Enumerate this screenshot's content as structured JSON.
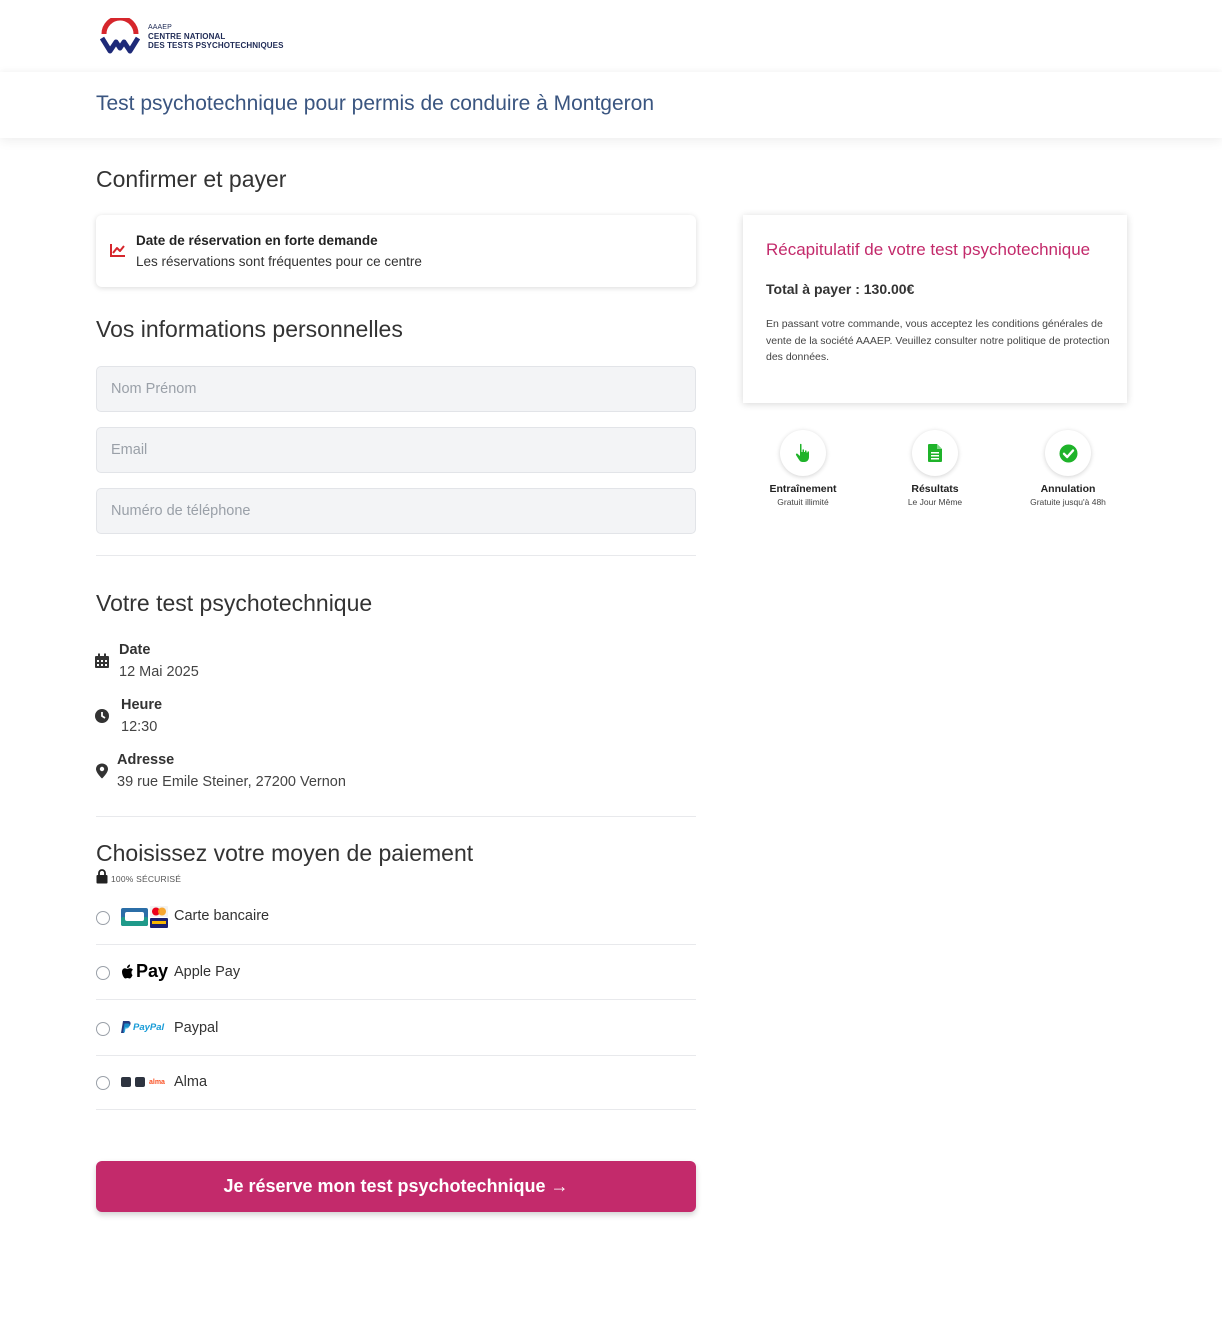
{
  "header": {
    "logo_lines": [
      "AAAEP",
      "CENTRE NATIONAL",
      "DES TESTS PSYCHOTECHNIQUES"
    ],
    "page_title": "Test psychotechnique pour permis de conduire à Montgeron"
  },
  "checkout": {
    "heading": "Confirmer et payer",
    "alert": {
      "title": "Date de réservation en forte demande",
      "text": "Les réservations sont fréquentes pour ce centre",
      "icon": "trend-chart-icon"
    }
  },
  "personal": {
    "heading": "Vos informations personnelles",
    "name_placeholder": "Nom Prénom",
    "email_placeholder": "Email",
    "phone_placeholder": "Numéro de téléphone"
  },
  "test": {
    "heading": "Votre test psychotechnique",
    "date_label": "Date",
    "date_value": "12 Mai 2025",
    "time_label": "Heure",
    "time_value": "12:30",
    "address_label": "Adresse",
    "address_value": "39 rue Emile Steiner, 27200 Vernon"
  },
  "payment": {
    "heading": "Choisissez votre moyen de paiement",
    "secure_label": "100% SÉCURISÉ",
    "methods": [
      {
        "label": "Carte bancaire",
        "logo": "card-logos-icon"
      },
      {
        "label": "Apple Pay",
        "logo": "apple-pay-icon",
        "logo_text": "Pay"
      },
      {
        "label": "Paypal",
        "logo": "paypal-icon",
        "logo_text": "PayPal"
      },
      {
        "label": "Alma",
        "logo": "alma-icon",
        "logo_text": "alma"
      }
    ]
  },
  "cta": {
    "label": "Je réserve mon test psychotechnique →"
  },
  "summary": {
    "title": "Récapitulatif de votre test psychotechnique",
    "total": "Total à payer : 130.00€",
    "legal": "En passant votre commande, vous acceptez les conditions générales de vente de la société AAAEP. Veuillez consulter notre politique de protection des données."
  },
  "features": [
    {
      "title": "Entraînement",
      "sub": "Gratuit illimité",
      "icon": "pointer-hand-icon"
    },
    {
      "title": "Résultats",
      "sub": "Le Jour Même",
      "icon": "document-icon"
    },
    {
      "title": "Annulation",
      "sub": "Gratuite jusqu'à 48h",
      "icon": "check-circle-icon"
    }
  ],
  "colors": {
    "brand": "#c32a6b",
    "title_blue": "#3a5580",
    "feature_green": "#1fb32a"
  }
}
